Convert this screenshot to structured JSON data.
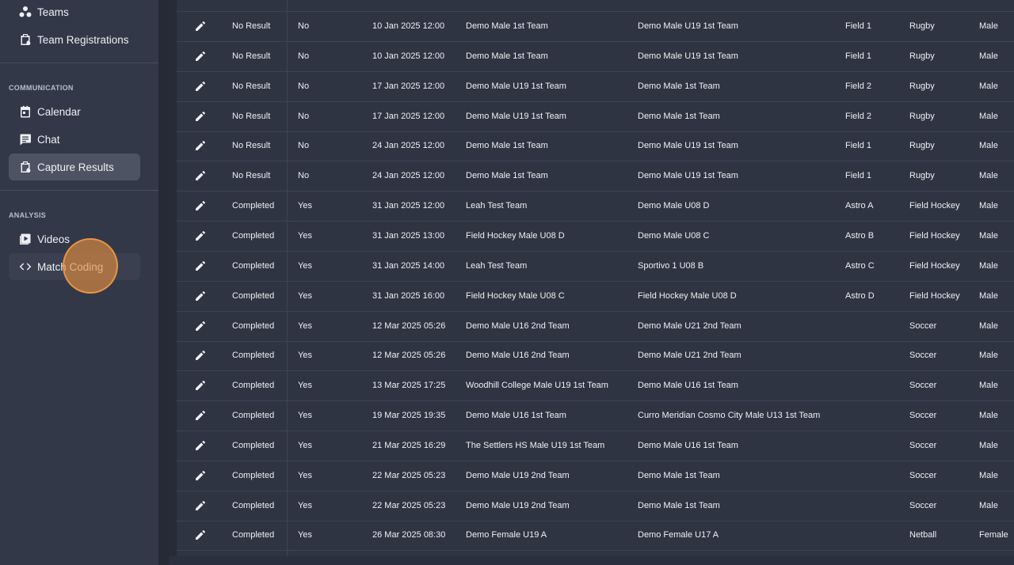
{
  "sidebar": {
    "items_top": [
      {
        "label": "Teams",
        "icon": "teams-icon"
      },
      {
        "label": "Team Registrations",
        "icon": "clipboard-icon"
      }
    ],
    "communication": {
      "heading": "COMMUNICATION",
      "items": [
        {
          "label": "Calendar",
          "icon": "calendar-icon"
        },
        {
          "label": "Chat",
          "icon": "chat-icon"
        },
        {
          "label": "Capture Results",
          "icon": "clipboard-icon",
          "active": true
        }
      ]
    },
    "analysis": {
      "heading": "ANALYSIS",
      "items": [
        {
          "label": "Videos",
          "icon": "video-icon"
        },
        {
          "label": "Match Coding",
          "icon": "code-icon",
          "hover": true
        }
      ]
    }
  },
  "colors": {
    "sidebar_bg": "#323848",
    "active_item": "#4d5363",
    "table_bg": "#2f3442",
    "cursor_highlight": "#e08e40"
  },
  "table": {
    "rows": [
      {
        "status": "No Result",
        "confirmed": "No",
        "date": "10 Jan 2025 12:00",
        "home": "Demo Male 1st Team",
        "away": "Demo Male U19 1st Team",
        "venue": "Field 1",
        "sport": "Rugby",
        "gender": "Male"
      },
      {
        "status": "No Result",
        "confirmed": "No",
        "date": "10 Jan 2025 12:00",
        "home": "Demo Male 1st Team",
        "away": "Demo Male U19 1st Team",
        "venue": "Field 1",
        "sport": "Rugby",
        "gender": "Male"
      },
      {
        "status": "No Result",
        "confirmed": "No",
        "date": "17 Jan 2025 12:00",
        "home": "Demo Male U19 1st Team",
        "away": "Demo Male 1st Team",
        "venue": "Field 2",
        "sport": "Rugby",
        "gender": "Male"
      },
      {
        "status": "No Result",
        "confirmed": "No",
        "date": "17 Jan 2025 12:00",
        "home": "Demo Male U19 1st Team",
        "away": "Demo Male 1st Team",
        "venue": "Field 2",
        "sport": "Rugby",
        "gender": "Male"
      },
      {
        "status": "No Result",
        "confirmed": "No",
        "date": "24 Jan 2025 12:00",
        "home": "Demo Male 1st Team",
        "away": "Demo Male U19 1st Team",
        "venue": "Field 1",
        "sport": "Rugby",
        "gender": "Male"
      },
      {
        "status": "No Result",
        "confirmed": "No",
        "date": "24 Jan 2025 12:00",
        "home": "Demo Male 1st Team",
        "away": "Demo Male U19 1st Team",
        "venue": "Field 1",
        "sport": "Rugby",
        "gender": "Male"
      },
      {
        "status": "Completed",
        "confirmed": "Yes",
        "date": "31 Jan 2025 12:00",
        "home": "Leah Test Team",
        "away": "Demo Male U08 D",
        "venue": "Astro A",
        "sport": "Field Hockey",
        "gender": "Male"
      },
      {
        "status": "Completed",
        "confirmed": "Yes",
        "date": "31 Jan 2025 13:00",
        "home": "Field Hockey Male U08 D",
        "away": "Demo Male U08 C",
        "venue": "Astro B",
        "sport": "Field Hockey",
        "gender": "Male"
      },
      {
        "status": "Completed",
        "confirmed": "Yes",
        "date": "31 Jan 2025 14:00",
        "home": "Leah Test Team",
        "away": "Sportivo 1 U08 B",
        "venue": "Astro C",
        "sport": "Field Hockey",
        "gender": "Male"
      },
      {
        "status": "Completed",
        "confirmed": "Yes",
        "date": "31 Jan 2025 16:00",
        "home": "Field Hockey Male U08 C",
        "away": "Field Hockey Male U08 D",
        "venue": "Astro D",
        "sport": "Field Hockey",
        "gender": "Male"
      },
      {
        "status": "Completed",
        "confirmed": "Yes",
        "date": "12 Mar 2025 05:26",
        "home": "Demo Male U16 2nd Team",
        "away": "Demo Male U21 2nd Team",
        "venue": "",
        "sport": "Soccer",
        "gender": "Male"
      },
      {
        "status": "Completed",
        "confirmed": "Yes",
        "date": "12 Mar 2025 05:26",
        "home": "Demo Male U16 2nd Team",
        "away": "Demo Male U21 2nd Team",
        "venue": "",
        "sport": "Soccer",
        "gender": "Male"
      },
      {
        "status": "Completed",
        "confirmed": "Yes",
        "date": "13 Mar 2025 17:25",
        "home": "Woodhill College Male U19 1st Team",
        "away": "Demo Male U16 1st Team",
        "venue": "",
        "sport": "Soccer",
        "gender": "Male"
      },
      {
        "status": "Completed",
        "confirmed": "Yes",
        "date": "19 Mar 2025 19:35",
        "home": "Demo Male U16 1st Team",
        "away": "Curro Meridian Cosmo City Male U13 1st Team",
        "venue": "",
        "sport": "Soccer",
        "gender": "Male"
      },
      {
        "status": "Completed",
        "confirmed": "Yes",
        "date": "21 Mar 2025 16:29",
        "home": "The Settlers HS Male U19 1st Team",
        "away": "Demo Male U16 1st Team",
        "venue": "",
        "sport": "Soccer",
        "gender": "Male"
      },
      {
        "status": "Completed",
        "confirmed": "Yes",
        "date": "22 Mar 2025 05:23",
        "home": "Demo Male U19 2nd Team",
        "away": "Demo Male 1st Team",
        "venue": "",
        "sport": "Soccer",
        "gender": "Male"
      },
      {
        "status": "Completed",
        "confirmed": "Yes",
        "date": "22 Mar 2025 05:23",
        "home": "Demo Male U19 2nd Team",
        "away": "Demo Male 1st Team",
        "venue": "",
        "sport": "Soccer",
        "gender": "Male"
      },
      {
        "status": "Completed",
        "confirmed": "Yes",
        "date": "26 Mar 2025 08:30",
        "home": "Demo Female U19 A",
        "away": "Demo Female U17 A",
        "venue": "",
        "sport": "Netball",
        "gender": "Female"
      }
    ]
  }
}
